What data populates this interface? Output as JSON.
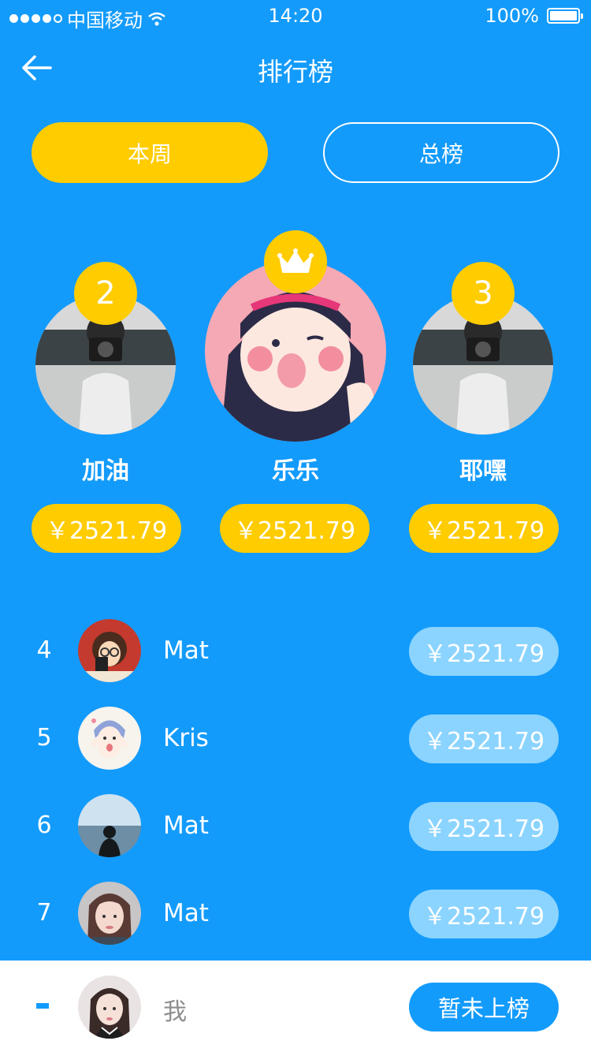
{
  "status_bar": {
    "carrier": "中国移动",
    "time": "14:20",
    "battery": "100%",
    "battery_level": 1.0,
    "icons": [
      "signal-dots-icon",
      "wifi-icon",
      "battery-icon"
    ]
  },
  "nav": {
    "title": "排行榜",
    "back_icon": "arrow-left-icon"
  },
  "tabs": [
    {
      "label": "本周",
      "active": true
    },
    {
      "label": "总榜",
      "active": false
    }
  ],
  "podium": [
    {
      "rank": "2",
      "name": "加油",
      "amount": "￥2521.79"
    },
    {
      "rank": "1",
      "name": "乐乐",
      "amount": "￥2521.79",
      "badge_icon": "crown-icon"
    },
    {
      "rank": "3",
      "name": "耶嘿",
      "amount": "￥2521.79"
    }
  ],
  "list": [
    {
      "rank": "4",
      "name": "Mat",
      "amount": "￥2521.79"
    },
    {
      "rank": "5",
      "name": "Kris",
      "amount": "￥2521.79"
    },
    {
      "rank": "6",
      "name": "Mat",
      "amount": "￥2521.79"
    },
    {
      "rank": "7",
      "name": "Mat",
      "amount": "￥2521.79"
    }
  ],
  "me": {
    "name": "我",
    "status_label": "暂未上榜"
  },
  "colors": {
    "background": "#139BFB",
    "accent": "#FFCC00",
    "list_amount_bg": "#8BD4FF",
    "bottom_bar": "#FFFFFF"
  }
}
